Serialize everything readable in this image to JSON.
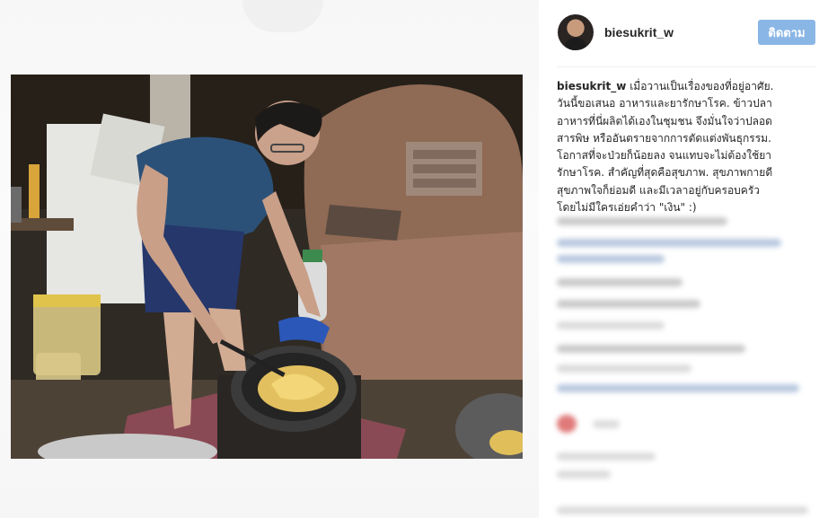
{
  "post": {
    "username": "biesukrit_w",
    "follow_label": "ติดตาม",
    "caption_user": "biesukrit_w",
    "caption_lines": [
      " เมื่อวานเป็นเรื่องของที่อยู่อาศัย.",
      "วันนี้ขอเสนอ อาหารและยารักษาโรค. ข้าวปลา",
      "อาหารที่นี่ผลิตได้เองในชุมชน จึงมั่นใจว่าปลอด",
      "สารพิษ หรืออันตรายจากการตัดแต่งพันธุกรรม.",
      "โอกาสที่จะป่วยก็น้อยลง จนแทบจะไม่ต้องใช้ยา",
      "รักษาโรค. สำคัญที่สุดคือสุขภาพ. สุขภาพกายดี",
      "สุขภาพใจก็ย่อมดี และมีเวลาอยู่กับครอบครัว",
      "โดยไม่มีใครเอ่ยคำว่า \"เงิน\" :)"
    ]
  },
  "icons": {
    "avatar": "profile-photo",
    "like": "heart-icon"
  },
  "colors": {
    "follow_button_bg": "#8ab6e6",
    "text": "#262626",
    "divider": "#efefef"
  }
}
